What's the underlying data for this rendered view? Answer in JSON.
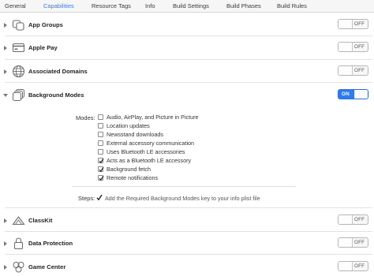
{
  "tabs": [
    {
      "label": "General",
      "active": false
    },
    {
      "label": "Capabilities",
      "active": true
    },
    {
      "label": "Resource Tags",
      "active": false
    },
    {
      "label": "Info",
      "active": false
    },
    {
      "label": "Build Settings",
      "active": false
    },
    {
      "label": "Build Phases",
      "active": false
    },
    {
      "label": "Build Rules",
      "active": false
    }
  ],
  "capabilities": [
    {
      "name": "App Groups",
      "toggle": "OFF",
      "expanded": false,
      "icon": "app-groups-icon"
    },
    {
      "name": "Apple Pay",
      "toggle": "OFF",
      "expanded": false,
      "icon": "apple-pay-icon"
    },
    {
      "name": "Associated Domains",
      "toggle": "OFF",
      "expanded": false,
      "icon": "globe-icon"
    },
    {
      "name": "Background Modes",
      "toggle": "ON",
      "expanded": true,
      "icon": "background-modes-icon"
    },
    {
      "name": "ClassKit",
      "toggle": "OFF",
      "expanded": false,
      "icon": "classkit-icon"
    },
    {
      "name": "Data Protection",
      "toggle": "OFF",
      "expanded": false,
      "icon": "lock-icon"
    },
    {
      "name": "Game Center",
      "toggle": "OFF",
      "expanded": false,
      "icon": "game-center-icon"
    }
  ],
  "background_modes": {
    "label": "Modes:",
    "items": [
      {
        "label": "Audio, AirPlay, and Picture in Picture",
        "checked": false
      },
      {
        "label": "Location updates",
        "checked": false
      },
      {
        "label": "Newsstand downloads",
        "checked": false
      },
      {
        "label": "External accessory communication",
        "checked": false
      },
      {
        "label": "Uses Bluetooth LE accessories",
        "checked": false
      },
      {
        "label": "Acts as a Bluetooth LE accessory",
        "checked": true
      },
      {
        "label": "Background fetch",
        "checked": true
      },
      {
        "label": "Remote notifications",
        "checked": true
      }
    ],
    "steps_label": "Steps:",
    "steps_text": "Add the Required Background Modes key to your info plist file"
  },
  "colors": {
    "accent": "#2f7bf5",
    "separator": "#e2e2e2"
  }
}
